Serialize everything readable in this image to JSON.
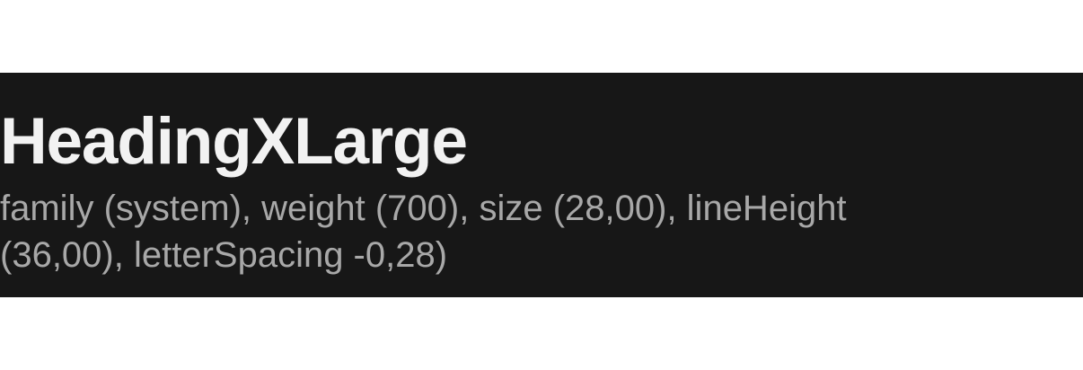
{
  "typography_sample": {
    "name": "HeadingXLarge",
    "description": "family (system), weight (700), size (28,00), lineHeight (36,00), letterSpacing -0,28)"
  },
  "colors": {
    "page_background": "#ffffff",
    "panel_background": "#171717",
    "heading_text": "#f2f2f2",
    "description_text": "#a8a8a8"
  }
}
